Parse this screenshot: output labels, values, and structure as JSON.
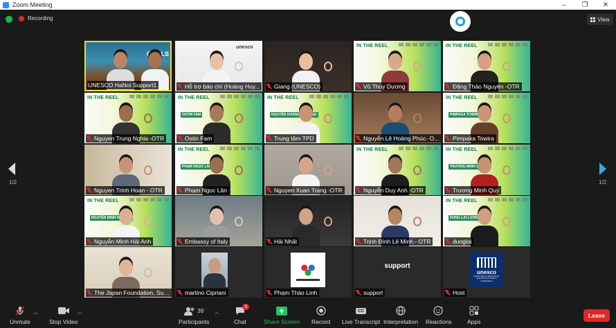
{
  "window": {
    "title": "Zoom Meeting"
  },
  "top": {
    "recording_label": "Recording",
    "view_label": "View"
  },
  "pager": {
    "left": "1/2",
    "right": "1/2"
  },
  "tiles": [
    {
      "name": "UNESCO HaNoi Support1",
      "muted": false,
      "active": true
    },
    {
      "name": "Hỗ trợ báo chí (Hoàng Huy...",
      "muted": true
    },
    {
      "name": "Giang (UNESCO)",
      "muted": true
    },
    {
      "name": "Vũ Thùy Dương",
      "muted": true
    },
    {
      "name": "Đặng Thảo Nguyên -OTR",
      "muted": true
    },
    {
      "name": "Nguyen Trung Nghia -OTR",
      "muted": true
    },
    {
      "name": "Ostin Fam",
      "muted": true
    },
    {
      "name": "Trung tâm TPD",
      "muted": true
    },
    {
      "name": "Nguyễn Lê Hoàng Phúc- O...",
      "muted": true
    },
    {
      "name": "Pimpaka Towira",
      "muted": true
    },
    {
      "name": "Nguyen Trinh Hoan - OTR",
      "muted": true
    },
    {
      "name": "Phạm Ngọc Lân",
      "muted": true
    },
    {
      "name": "Nguyen Xuan Trang -OTR",
      "muted": true
    },
    {
      "name": "Nguyễn Duy Anh -OTR",
      "muted": true
    },
    {
      "name": "Trương Minh Quý",
      "muted": true
    },
    {
      "name": "Nguyễn Minh Hải Anh",
      "muted": true
    },
    {
      "name": "Embassy of Italy",
      "muted": true
    },
    {
      "name": "Hải Nhất",
      "muted": true
    },
    {
      "name": "Trịnh Đình Lê Minh - OTR",
      "muted": true
    },
    {
      "name": "dunglai",
      "muted": true
    },
    {
      "name": "The Japan Foundation, Sug...",
      "muted": true
    },
    {
      "name": "martino Cipriani",
      "muted": true
    },
    {
      "name": "Phạm Thảo Linh",
      "muted": true
    },
    {
      "name": "support",
      "muted": true
    },
    {
      "name": "Host",
      "muted": true
    }
  ],
  "banner_texts": {
    "in_the_reel": "IN THE REEL",
    "goals": "GOALS",
    "unesco_small": "unesco",
    "ostin": "OSTIN FAM",
    "nguyen": "NGUYỄN HOÀNG PHƯƠNG",
    "pimpaka": "PIMPAKA TOWIRA",
    "pham": "PHẠM NGỌC LÂN",
    "truong": "TRƯƠNG MINH QUÝ",
    "hai_anh": "NGUYỄN MINH HẢI ANH",
    "dung": "DUNG LAI LUONG LAI",
    "support_display": "support",
    "host_logo": "unesco",
    "host_logo_sub": "United Nations Educational, Scientific and Cultural Organization"
  },
  "toolbar": {
    "unmute": "Unmute",
    "stop_video": "Stop Video",
    "participants": "Participants",
    "participants_count": "39",
    "chat": "Chat",
    "chat_badge": "3",
    "share_screen": "Share Screen",
    "record": "Record",
    "live_transcript": "Live Transcript",
    "cc": "CC",
    "interpretation": "Interpretation",
    "reactions": "Reactions",
    "apps": "Apps",
    "leave": "Leave"
  },
  "colors": {
    "active_border": "#e6df3d",
    "share_green": "#22c55e",
    "leave_red": "#e02828",
    "muted_red": "#e02828"
  }
}
